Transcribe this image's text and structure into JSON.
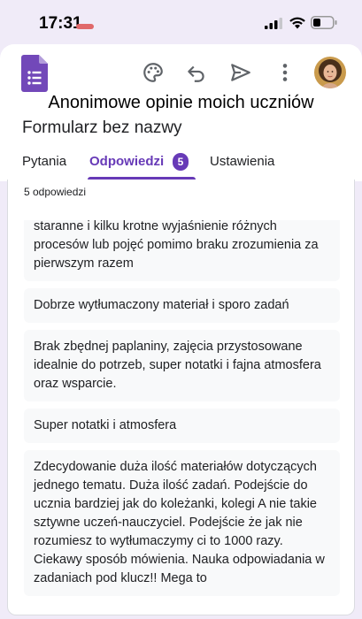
{
  "status_bar": {
    "time": "17:31"
  },
  "header": {
    "form_title": "Anonimowe opinie moich uczniów",
    "form_subtitle": "Formularz bez nazwy",
    "icons": [
      "palette-icon",
      "undo-icon",
      "send-icon",
      "more-vert-icon"
    ]
  },
  "tabs": [
    {
      "label": "Pytania"
    },
    {
      "label": "Odpowiedzi",
      "badge": "5"
    },
    {
      "label": "Ustawienia"
    }
  ],
  "responses_panel": {
    "count_label": "5 odpowiedzi",
    "items": [
      "staranne i kilku krotne wyjaśnienie różnych procesów lub pojęć pomimo braku zrozumienia za pierwszym razem",
      "Dobrze wytłumaczony materiał i sporo zadań",
      "Brak zbędnej paplaniny, zajęcia przystosowane idealnie do potrzeb, super notatki i fajna atmosfera oraz wsparcie.",
      "Super notatki i atmosfera",
      "Zdecydowanie duża ilość materiałów dotyczących jednego tematu. Duża ilość zadań. Podejście do ucznia bardziej jak do koleżanki, kolegi A nie takie sztywne uczeń-nauczyciel. Podejście że jak nie rozumiesz to wytłumaczymy ci to 1000 razy. Ciekawy sposób mówienia. Nauka odpowiadania w zadaniach pod klucz!! Mega to"
    ]
  },
  "colors": {
    "accent": "#673ab7",
    "background": "#f0ebf8",
    "response_bg": "#f8f9fa"
  }
}
